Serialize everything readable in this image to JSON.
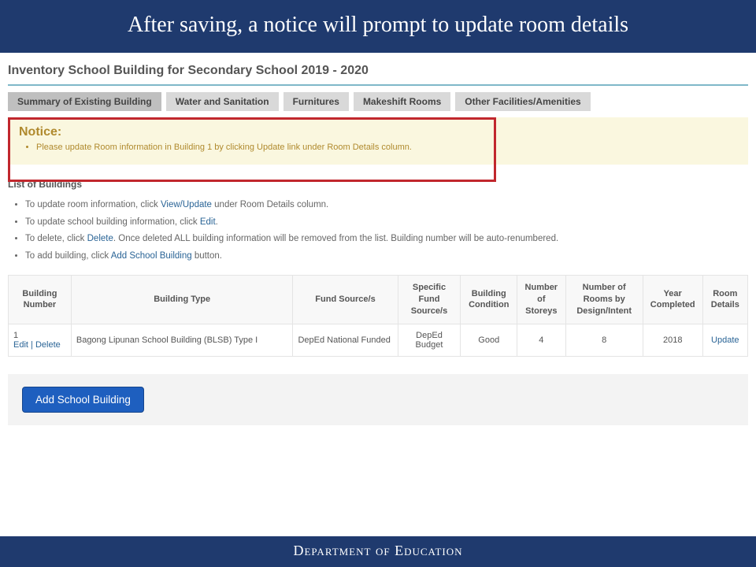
{
  "slide": {
    "title": "After saving, a notice will prompt to update room details"
  },
  "page": {
    "title": "Inventory School Building for Secondary School 2019 - 2020"
  },
  "tabs": [
    "Summary of Existing Building",
    "Water and Sanitation",
    "Furnitures",
    "Makeshift Rooms",
    "Other Facilities/Amenities"
  ],
  "notice": {
    "title": "Notice:",
    "items": [
      "Please update Room information in Building 1 by clicking Update link under Room Details column."
    ]
  },
  "list_section": {
    "title": "List of Buildings",
    "instructions": [
      {
        "pre": "To update room information, click ",
        "link": "View/Update",
        "post": " under Room Details column."
      },
      {
        "pre": "To update school building information, click ",
        "link": "Edit",
        "post": "."
      },
      {
        "pre": "To delete, click ",
        "link": "Delete",
        "post": ". Once deleted ALL building information will be removed from the list. Building number will be auto-renumbered."
      },
      {
        "pre": "To add building, click ",
        "link": "Add School Building",
        "post": " button."
      }
    ]
  },
  "table": {
    "headers": [
      "Building Number",
      "Building Type",
      "Fund Source/s",
      "Specific Fund Source/s",
      "Building Condition",
      "Number of Storeys",
      "Number of Rooms by Design/Intent",
      "Year Completed",
      "Room Details"
    ],
    "rows": [
      {
        "number": "1",
        "edit": "Edit",
        "sep": " | ",
        "delete": "Delete",
        "type": "Bagong Lipunan School Building (BLSB) Type I",
        "fund": "DepEd National Funded",
        "specific": "DepEd Budget",
        "condition": "Good",
        "storeys": "4",
        "rooms": "8",
        "year": "2018",
        "details": "Update"
      }
    ]
  },
  "buttons": {
    "add": "Add School Building"
  },
  "footer": "Department of Education"
}
